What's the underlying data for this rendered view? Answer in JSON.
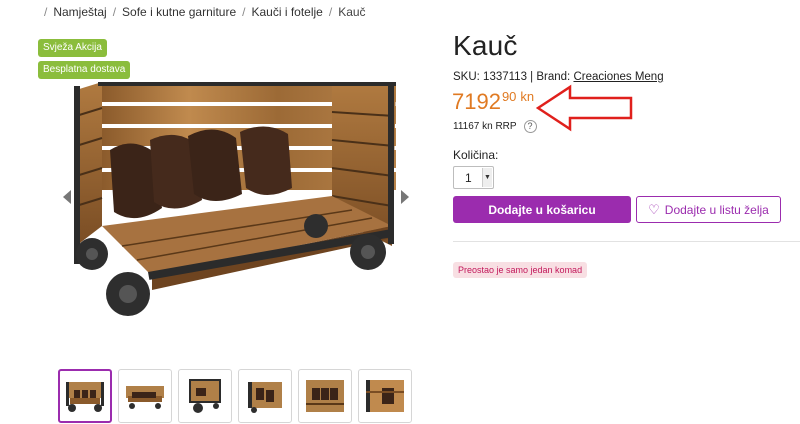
{
  "breadcrumb": {
    "items": [
      "Namještaj",
      "Sofe i kutne garniture",
      "Kauči i fotelje"
    ],
    "current": "Kauč",
    "separator": "/"
  },
  "badges": [
    "Svježa Akcija",
    "Besplatna dostava"
  ],
  "product": {
    "title": "Kauč",
    "sku_label": "SKU:",
    "sku": "1337113",
    "brand_sep": "|",
    "brand_label": "Brand:",
    "brand": "Creaciones Meng",
    "price_int": "7192",
    "price_dec": "90",
    "currency": "kn",
    "rrp": "11167 kn RRP",
    "help_symbol": "?",
    "qty_label": "Količina:",
    "qty_value": "1",
    "add_to_cart": "Dodajte u košaricu",
    "wishlist": "Dodajte u listu želja",
    "stock_notice": "Preostao je samo jedan komad"
  },
  "icons": {
    "prev": "chevron-left-icon",
    "next": "chevron-right-icon",
    "heart": "heart-icon",
    "help": "question-icon",
    "annotation": "red-arrow-annotation"
  },
  "colors": {
    "accent": "#9b2cae",
    "price": "#e07a22",
    "badge": "#8bbd3c",
    "stock_bg": "#f8dfe3",
    "stock_text": "#c2185b",
    "annotation": "#e0201c"
  }
}
